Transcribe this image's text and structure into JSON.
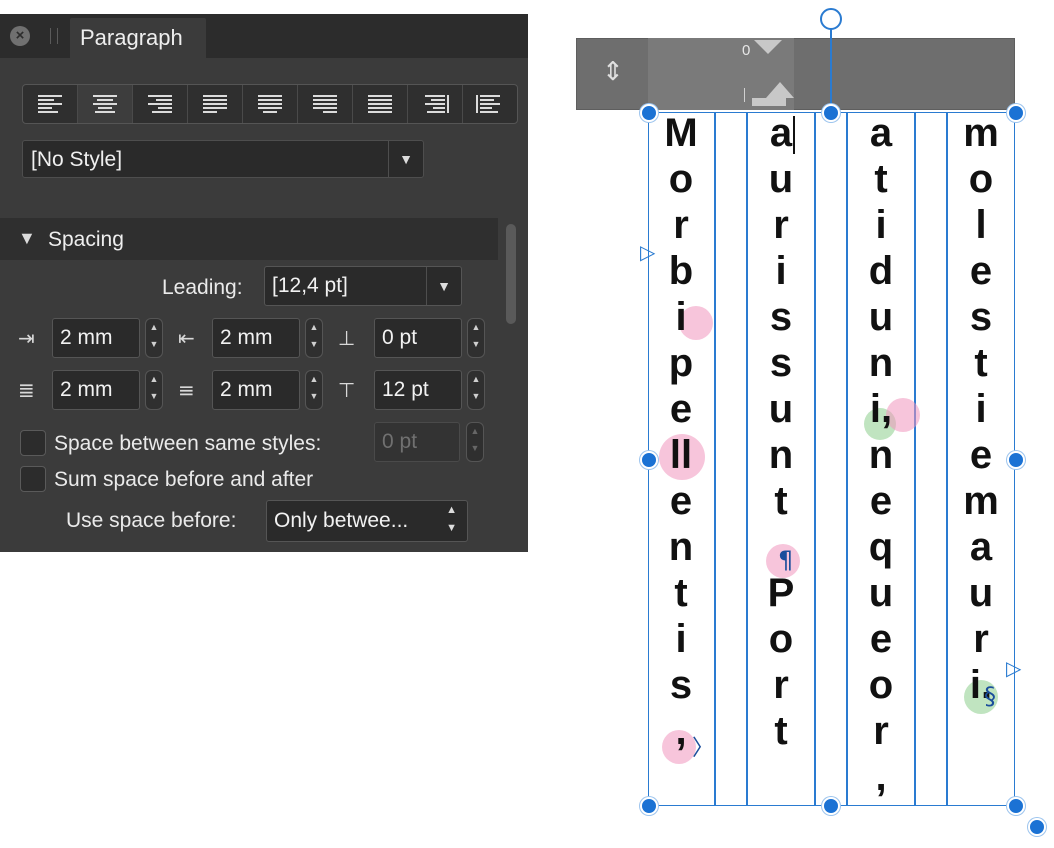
{
  "panel": {
    "tab_title": "Paragraph",
    "alignment_buttons": [
      "align-left",
      "align-center",
      "align-right",
      "justify-left",
      "justify-center",
      "justify-right",
      "justify-all",
      "align-towards-spine",
      "align-away-from-spine"
    ],
    "active_alignment": "align-center",
    "style_value": "[No Style]",
    "section_title": "Spacing",
    "leading_label": "Leading:",
    "leading_value": "[12,4 pt]",
    "left_indent": "2 mm",
    "right_indent": "2 mm",
    "space_after": "0 pt",
    "first_line_indent": "2 mm",
    "last_line_indent": "2 mm",
    "space_before": "12 pt",
    "space_between_label": "Space between same styles:",
    "space_between_value": "0 pt",
    "sum_space_label": "Sum space before and after",
    "use_space_before_label": "Use space before:",
    "use_space_before_value": "Only betwee..."
  },
  "ruler": {
    "zero_label": "0"
  },
  "text_frame": {
    "columns": [
      [
        "M",
        "o",
        "r",
        "b",
        "i",
        "p",
        "e",
        "ll",
        "e",
        "n",
        "t",
        "i",
        "s",
        ","
      ],
      [
        "a",
        "u",
        "r",
        "i",
        "s",
        "s",
        "u",
        "n",
        "t",
        "",
        "P",
        "o",
        "r",
        "t"
      ],
      [
        "a",
        "t",
        "i",
        "d",
        "u",
        "n",
        "i,",
        "n",
        "e",
        "q",
        "u",
        "e",
        "o",
        "r",
        ","
      ],
      [
        "m",
        "o",
        "l",
        "e",
        "s",
        "t",
        "i",
        "e",
        "m",
        "a",
        "u",
        "r",
        "i."
      ]
    ],
    "pilcrow_glyph": "¶",
    "section_glyph": "§",
    "frame_color": "#2a7bd1",
    "handle_color": "#1b72d4"
  }
}
